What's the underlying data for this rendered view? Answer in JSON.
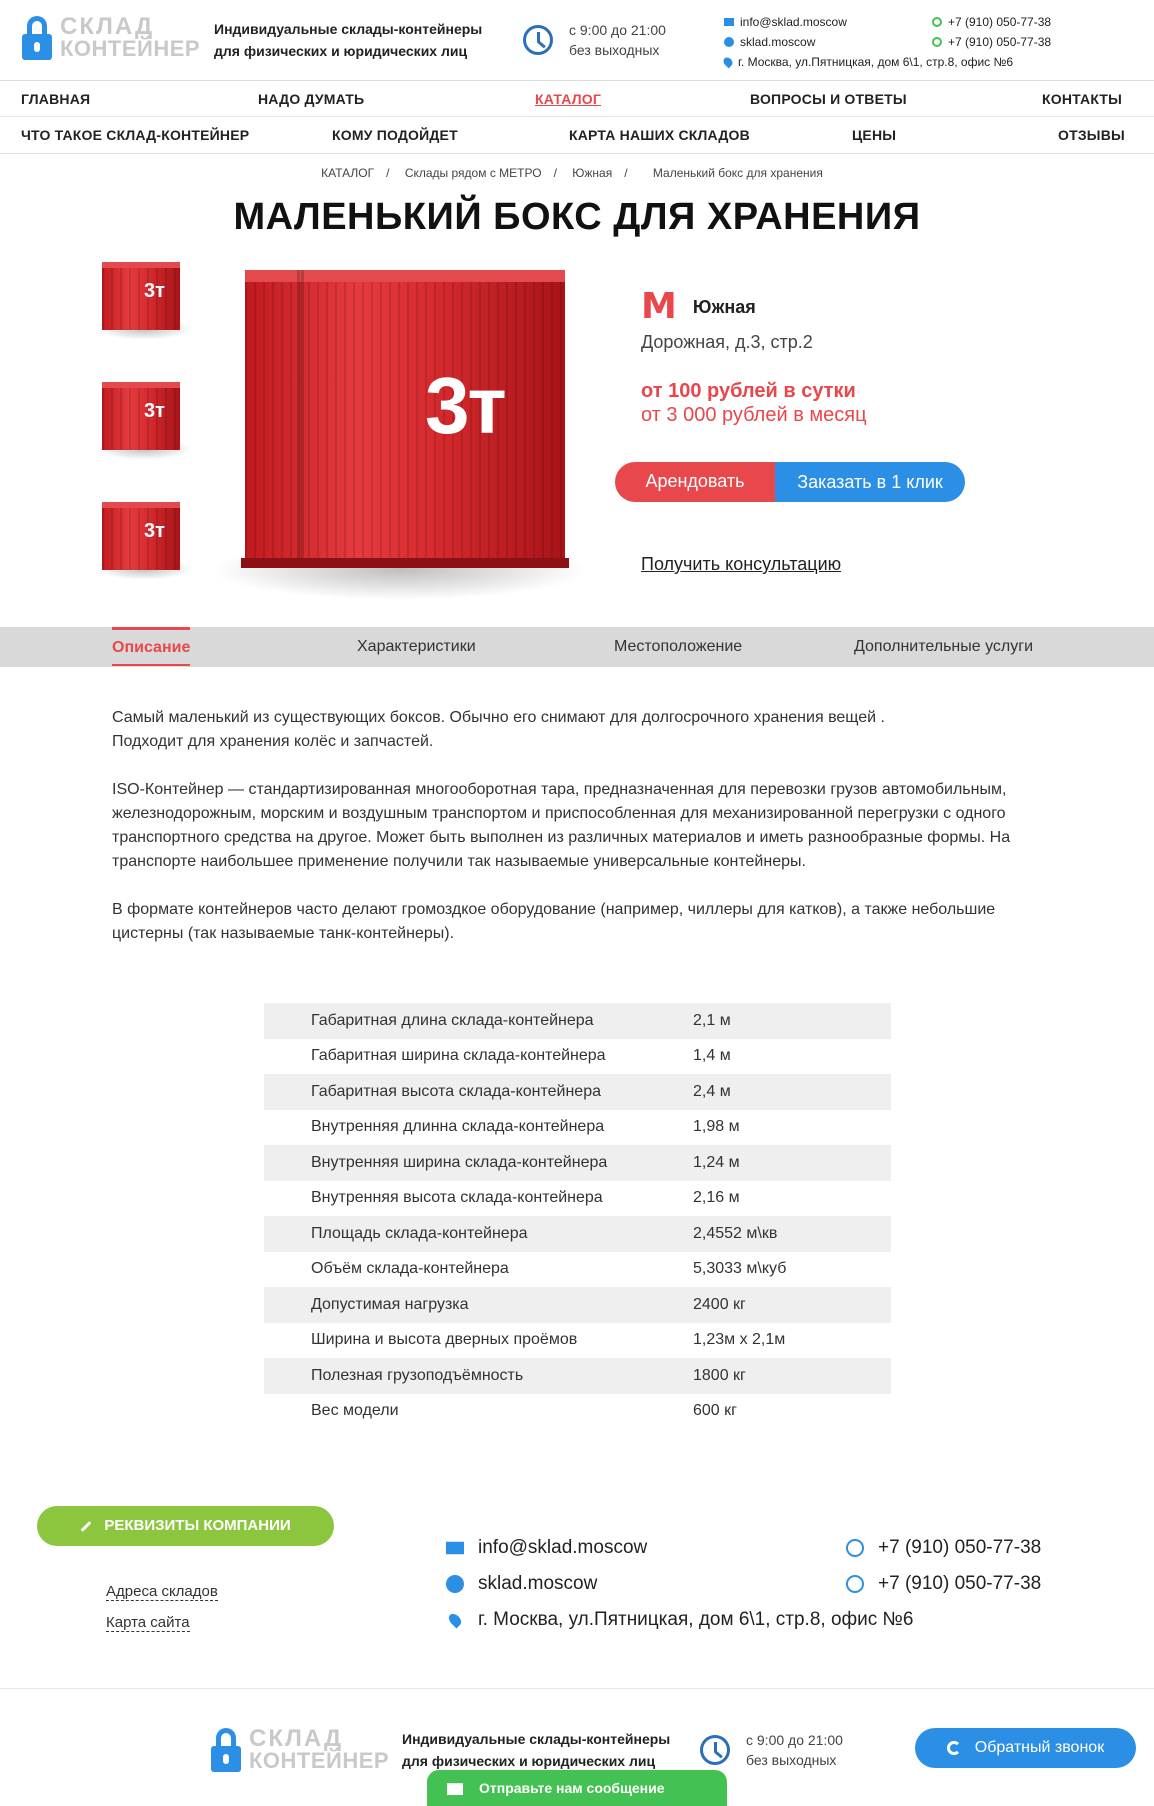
{
  "header": {
    "logo_line1": "СКЛАД",
    "logo_line2": "КОНТЕЙНЕР",
    "tagline_line1": "Индивидуальные склады-контейнеры",
    "tagline_line2": "для физических и юридических лиц",
    "hours_line1": "с 9:00 до 21:00",
    "hours_line2": "без выходных",
    "email": "info@sklad.moscow",
    "skype": "sklad.moscow",
    "address": "г. Москва, ул.Пятницкая, дом 6\\1, стр.8, офис №6",
    "phone1": "+7 (910) 050-77-38",
    "phone2": "+7 (910) 050-77-38"
  },
  "nav": {
    "row1": [
      "ГЛАВНАЯ",
      "НАДО ДУМАТЬ",
      "КАТАЛОГ",
      "ВОПРОСЫ И ОТВЕТЫ",
      "КОНТАКТЫ"
    ],
    "row2": [
      "ЧТО ТАКОЕ СКЛАД-КОНТЕЙНЕР",
      "КОМУ ПОДОЙДЕТ",
      "КАРТА НАШИХ СКЛАДОВ",
      "ЦЕНЫ",
      "ОТЗЫВЫ"
    ],
    "active": "КАТАЛОГ"
  },
  "breadcrumb": [
    "КАТАЛОГ",
    "Склады рядом с МЕТРО",
    "Южная",
    "Маленький бокс для хранения"
  ],
  "title": "МАЛЕНЬКИЙ БОКС ДЛЯ ХРАНЕНИЯ",
  "product": {
    "container_label": "3т",
    "metro_icon": "М",
    "metro": "Южная",
    "address": "Дорожная, д.3, стр.2",
    "price_day": "от 100 рублей в сутки",
    "price_month": "от 3 000 рублей в месяц",
    "rent_label": "Арендовать",
    "order_label": "Заказать в 1 клик",
    "consult_label": "Получить консультацию"
  },
  "tabs": [
    "Описание",
    "Характеристики",
    "Местоположение",
    "Дополнительные услуги"
  ],
  "description": [
    "Самый маленький из существующих боксов. Обычно его снимают для долгосрочного хранения вещей .",
    "Подходит для хранения колёс и запчастей.",
    "ISO-Контейнер — стандартизированная многооборотная тара, предназначенная для перевозки грузов автомобильным, железнодорожным, морским и воздушным транспортом и приспособленная для механизированной перегрузки с одного транспортного средства на другое. Может быть выполнен из различных материалов и иметь разнообразные формы. На транспорте наибольшее применение получили так называемые универсальные контейнеры.",
    "В формате контейнеров часто делают громоздкое оборудование (например, чиллеры для катков), а также небольшие цистерны (так называемые танк-контейнеры)."
  ],
  "specs": [
    {
      "k": "Габаритная длина склада-контейнера",
      "v": "2,1 м"
    },
    {
      "k": "Габаритная ширина склада-контейнера",
      "v": "1,4 м"
    },
    {
      "k": "Габаритная высота склада-контейнера",
      "v": "2,4 м"
    },
    {
      "k": "Внутренняя длинна склада-контейнера",
      "v": "1,98 м"
    },
    {
      "k": "Внутренняя ширина склада-контейнера",
      "v": "1,24 м"
    },
    {
      "k": "Внутренняя высота склада-контейнера",
      "v": "2,16 м"
    },
    {
      "k": "Площадь склада-контейнера",
      "v": "2,4552 м\\кв"
    },
    {
      "k": "Объём склада-контейнера",
      "v": "5,3033 м\\куб"
    },
    {
      "k": "Допустимая нагрузка",
      "v": "2400 кг"
    },
    {
      "k": "Ширина и высота дверных проёмов",
      "v": "1,23м х 2,1м"
    },
    {
      "k": "Полезная грузоподъёмность",
      "v": "1800 кг"
    },
    {
      "k": "Вес модели",
      "v": "600 кг"
    }
  ],
  "footer": {
    "requisites_label": "РЕКВИЗИТЫ КОМПАНИИ",
    "link1": "Адреса складов",
    "link2": "Карта сайта",
    "email": "info@sklad.moscow",
    "skype": "sklad.moscow",
    "address": "г. Москва, ул.Пятницкая, дом 6\\1, стр.8, офис №6",
    "phone1": "+7 (910) 050-77-38",
    "phone2": "+7 (910) 050-77-38",
    "callback_label": "Обратный звонок",
    "message_label": "Отправьте нам сообщение"
  },
  "colors": {
    "accent_red": "#e8474b",
    "accent_blue": "#2c8fe6",
    "accent_green": "#8cc63f",
    "chat_green": "#43c152"
  },
  "icons": [
    "lock-icon",
    "clock-icon",
    "mail-icon",
    "skype-icon",
    "location-pin-icon",
    "whatsapp-icon",
    "metro-icon",
    "pencil-icon",
    "phone-icon",
    "envelope-icon"
  ]
}
